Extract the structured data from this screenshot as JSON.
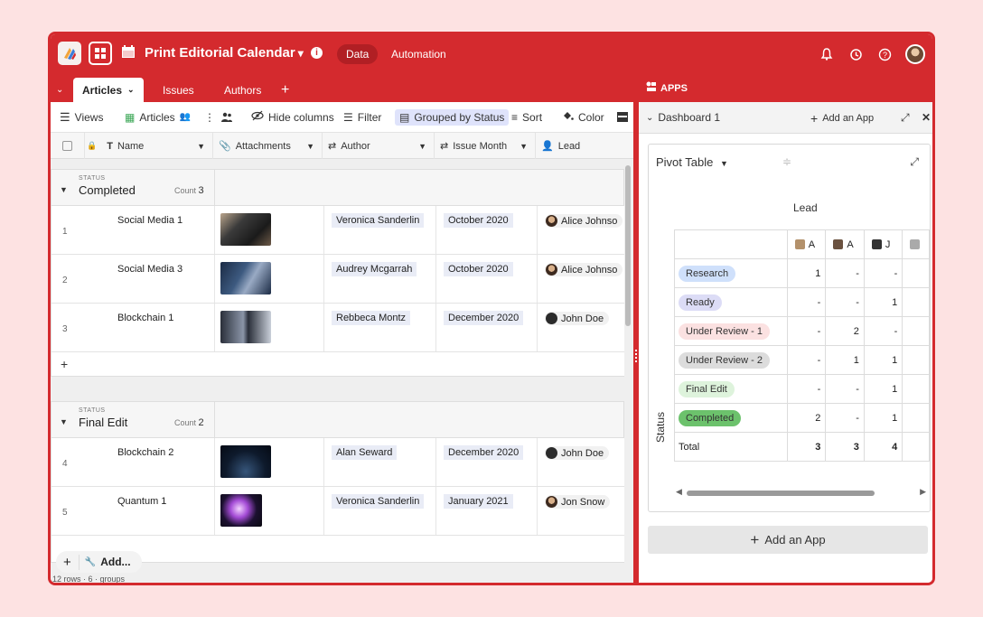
{
  "topbar": {
    "title": "Print Editorial Calendar",
    "title_caret": "▾",
    "info": "i",
    "tab_data": "Data",
    "tab_automation": "Automation"
  },
  "tabs": {
    "articles": "Articles",
    "issues": "Issues",
    "authors": "Authors",
    "add": "+"
  },
  "toolbar": {
    "views": "Views",
    "articles": "Articles",
    "hide_columns": "Hide columns",
    "filter": "Filter",
    "grouped_by": "Grouped by Status",
    "sort": "Sort",
    "color": "Color"
  },
  "columns": {
    "name": "Name",
    "attachments": "Attachments",
    "author": "Author",
    "issue_month": "Issue Month",
    "lead": "Lead"
  },
  "groups": [
    {
      "label": "STATUS",
      "name": "Completed",
      "count_label": "Count",
      "count": "3",
      "rows": [
        {
          "num": "1",
          "name": "Social Media 1",
          "author": "Veronica Sanderlin",
          "month": "October 2020",
          "lead": "Alice Johnso"
        },
        {
          "num": "2",
          "name": "Social Media 3",
          "author": "Audrey Mcgarrah",
          "month": "October 2020",
          "lead": "Alice Johnso"
        },
        {
          "num": "3",
          "name": "Blockchain 1",
          "author": "Rebbeca Montz",
          "month": "December 2020",
          "lead": "John Doe"
        }
      ]
    },
    {
      "label": "STATUS",
      "name": "Final Edit",
      "count_label": "Count",
      "count": "2",
      "rows": [
        {
          "num": "4",
          "name": "Blockchain 2",
          "author": "Alan Seward",
          "month": "December 2020",
          "lead": "John Doe"
        },
        {
          "num": "5",
          "name": "Quantum 1",
          "author": "Veronica Sanderlin",
          "month": "January 2021",
          "lead": "Jon Snow"
        }
      ]
    }
  ],
  "grid_footer": {
    "add_row": "+",
    "add": "Add...",
    "summary": "12 rows · 6 · groups"
  },
  "apps": {
    "header": "APPS",
    "dashboard": "Dashboard 1",
    "add_an_app_small": "Add an App",
    "pivot_title": "Pivot Table",
    "lead_label": "Lead",
    "status_label": "Status",
    "col_headers": [
      "A",
      "A",
      "J",
      ""
    ],
    "pivot_rows": [
      {
        "label": "Research",
        "color": "#cfe0fb",
        "vals": [
          "1",
          "-",
          "-"
        ]
      },
      {
        "label": "Ready",
        "color": "#dcdcf6",
        "vals": [
          "-",
          "-",
          "1"
        ]
      },
      {
        "label": "Under Review - 1",
        "color": "#fbe1e1",
        "vals": [
          "-",
          "2",
          "-"
        ]
      },
      {
        "label": "Under Review - 2",
        "color": "#dcdcdc",
        "vals": [
          "-",
          "1",
          "1"
        ]
      },
      {
        "label": "Final Edit",
        "color": "#def3dc",
        "vals": [
          "-",
          "-",
          "1"
        ]
      },
      {
        "label": "Completed",
        "color": "#6cc26c",
        "vals": [
          "2",
          "-",
          "1"
        ]
      }
    ],
    "total_label": "Total",
    "totals": [
      "3",
      "3",
      "4"
    ],
    "add_an_app": "Add an App"
  },
  "colors": {
    "brand": "#d42a2e",
    "group_pill": "#dfe3fb"
  }
}
